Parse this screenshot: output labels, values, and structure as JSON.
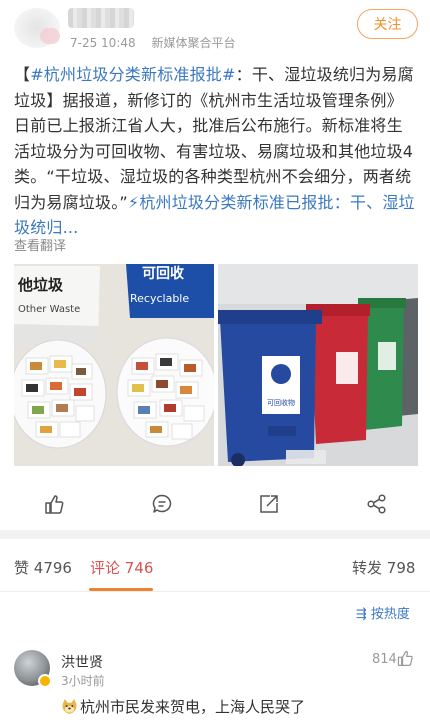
{
  "post": {
    "time": "7-25 10:48",
    "source": "新媒体聚合平台",
    "follow_label": "关注",
    "text_bracket_open": "【",
    "hashtag": "#杭州垃圾分类新标准报批#",
    "text_body": "：干、湿垃圾统归为易腐垃圾】据报道，新修订的《杭州市生活垃圾管理条例》日前已上报浙江省人大，批准后公布施行。新标准将生活垃圾分为可回收物、有害垃圾、易腐垃圾和其他垃圾4类。“干垃圾、湿垃圾的各种类型杭州不会细分，两者统归为易腐垃圾。”",
    "link_icon": "⚡",
    "link_text": "杭州垃圾分类新标准已报批：干、湿垃圾统归...",
    "see_translation": "查看翻译"
  },
  "images": {
    "left": {
      "sign_left": "他垃圾",
      "sign_left_sub": "Other Waste",
      "sign_right": "可回收",
      "sign_right_sub": "Recyclable"
    },
    "right": {
      "bin_label": "可回收物"
    }
  },
  "actions": {
    "like": "thumb-up-icon",
    "comment": "comment-icon",
    "repost": "repost-icon",
    "share": "share-icon"
  },
  "stats": {
    "likes_label": "赞",
    "likes_count": "4796",
    "comments_label": "评论",
    "comments_count": "746",
    "reposts_label": "转发",
    "reposts_count": "798"
  },
  "sort": {
    "label": "按热度"
  },
  "comment": {
    "name": "洪世贤",
    "time": "3小时前",
    "likes": "814",
    "text": "杭州市民发来贺电，上海人民哭了"
  },
  "colors": {
    "accent": "#f28f2e",
    "link": "#3b78c3",
    "active_tab": "#d9534f"
  }
}
